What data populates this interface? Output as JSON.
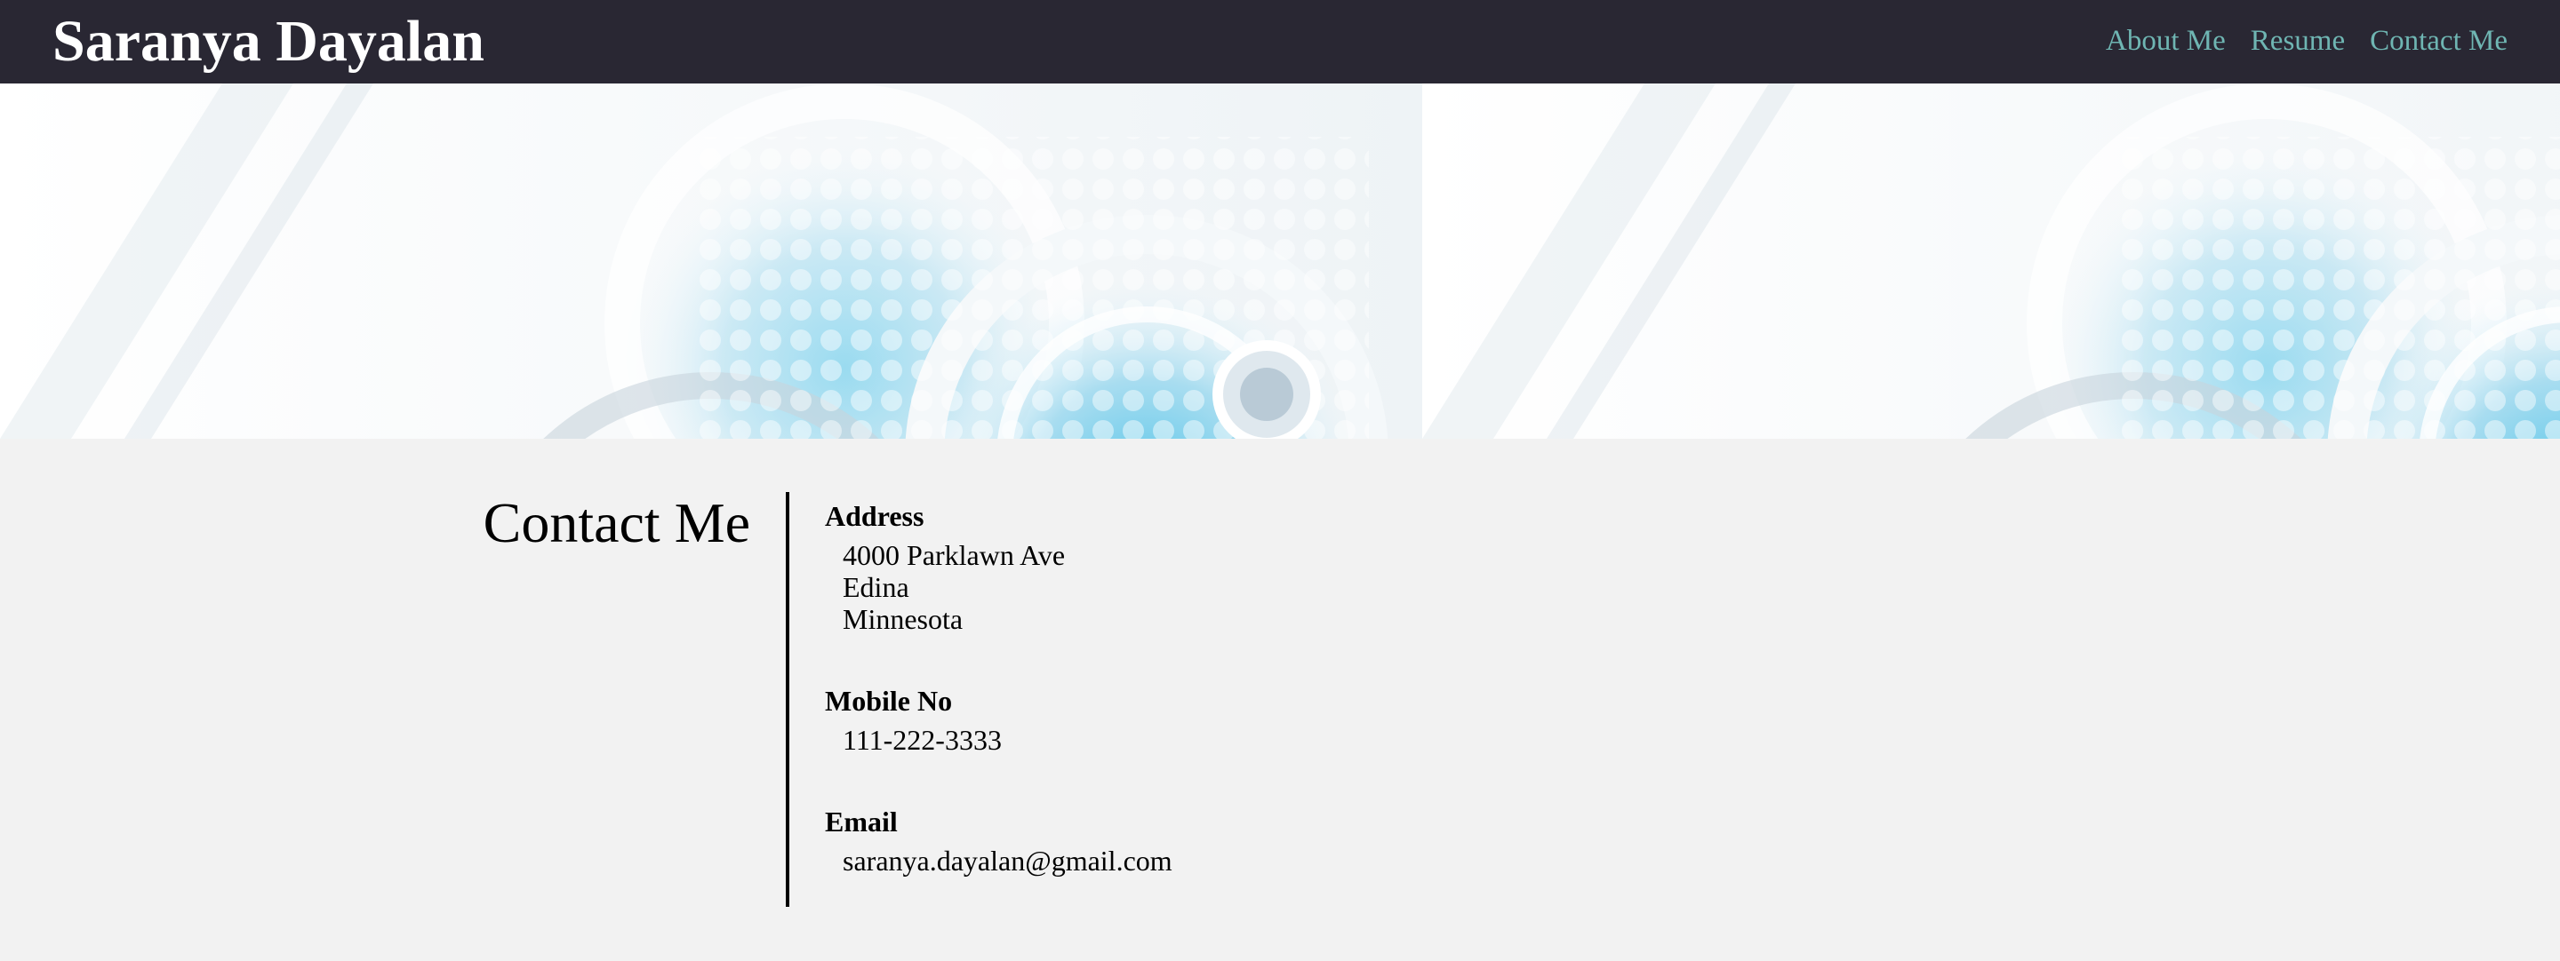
{
  "header": {
    "site_title": "Saranya Dayalan",
    "nav": [
      {
        "label": "About Me"
      },
      {
        "label": "Resume"
      },
      {
        "label": "Contact Me"
      }
    ],
    "colors": {
      "bar": "#292733",
      "title": "#ffffff",
      "link": "#6fb6b3"
    }
  },
  "hero": {
    "icon": "abstract-tech-circles-banner-image"
  },
  "contact": {
    "heading": "Contact Me",
    "address": {
      "label": "Address",
      "lines": [
        "4000 Parklawn Ave",
        "Edina",
        "Minnesota"
      ]
    },
    "mobile": {
      "label": "Mobile No",
      "value": "111-222-3333"
    },
    "email": {
      "label": "Email",
      "value": "saranya.dayalan@gmail.com"
    }
  }
}
